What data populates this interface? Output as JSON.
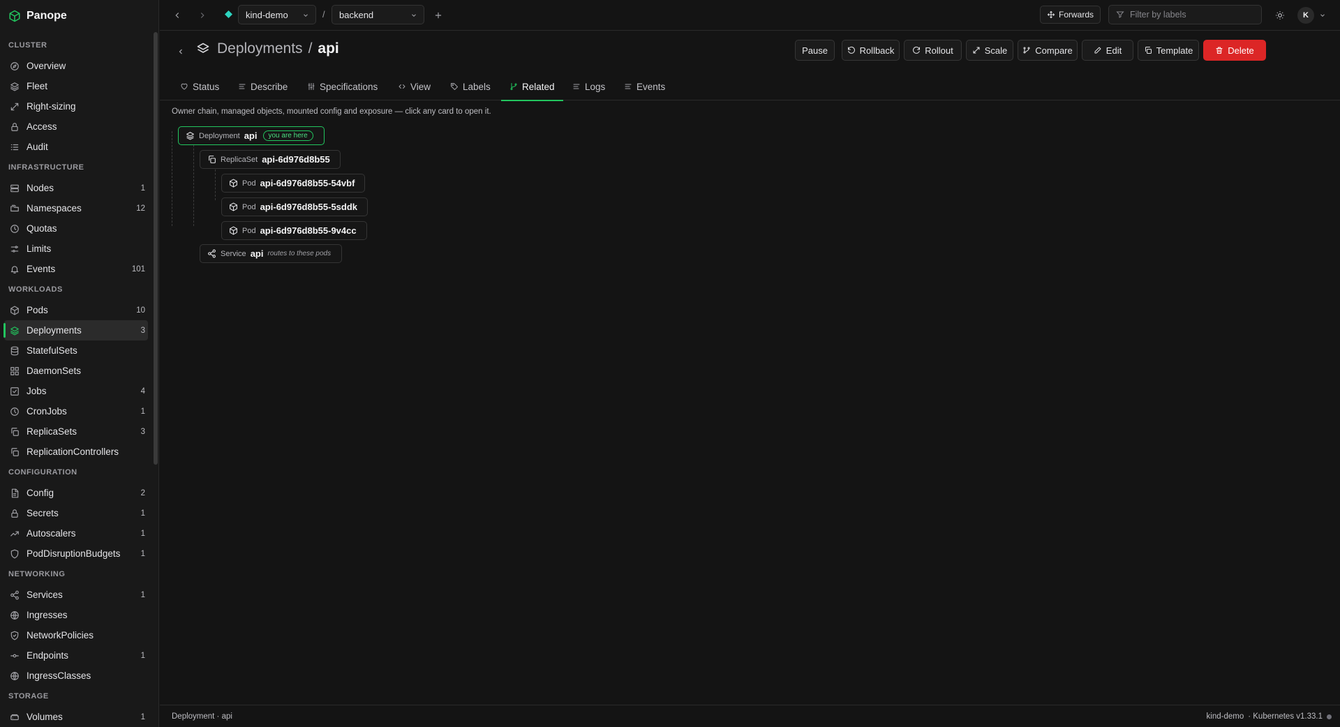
{
  "app": {
    "name": "Panope"
  },
  "colors": {
    "accent": "#22c55e",
    "danger": "#dc2626",
    "background": "#141414",
    "sidebar": "#191919"
  },
  "sidebar": {
    "sections": [
      {
        "title": "CLUSTER",
        "items": [
          {
            "label": "Overview",
            "icon": "compass-icon"
          },
          {
            "label": "Fleet",
            "icon": "layers-icon"
          },
          {
            "label": "Right-sizing",
            "icon": "resize-icon"
          },
          {
            "label": "Access",
            "icon": "lock-icon"
          },
          {
            "label": "Audit",
            "icon": "list-icon"
          }
        ]
      },
      {
        "title": "INFRASTRUCTURE",
        "items": [
          {
            "label": "Nodes",
            "icon": "server-icon",
            "count": "1"
          },
          {
            "label": "Namespaces",
            "icon": "folders-icon",
            "count": "12"
          },
          {
            "label": "Quotas",
            "icon": "gauge-icon"
          },
          {
            "label": "Limits",
            "icon": "sliders-icon"
          },
          {
            "label": "Events",
            "icon": "bell-icon",
            "count": "101"
          }
        ]
      },
      {
        "title": "WORKLOADS",
        "items": [
          {
            "label": "Pods",
            "icon": "box-icon",
            "count": "10"
          },
          {
            "label": "Deployments",
            "icon": "layers-icon",
            "count": "3",
            "active": true
          },
          {
            "label": "StatefulSets",
            "icon": "database-icon"
          },
          {
            "label": "DaemonSets",
            "icon": "grid-icon"
          },
          {
            "label": "Jobs",
            "icon": "check-square-icon",
            "count": "4"
          },
          {
            "label": "CronJobs",
            "icon": "clock-icon",
            "count": "1"
          },
          {
            "label": "ReplicaSets",
            "icon": "copy-icon",
            "count": "3"
          },
          {
            "label": "ReplicationControllers",
            "icon": "copy-icon"
          }
        ]
      },
      {
        "title": "CONFIGURATION",
        "items": [
          {
            "label": "Config",
            "icon": "file-icon",
            "count": "2"
          },
          {
            "label": "Secrets",
            "icon": "lock-icon",
            "count": "1"
          },
          {
            "label": "Autoscalers",
            "icon": "trending-up-icon",
            "count": "1"
          },
          {
            "label": "PodDisruptionBudgets",
            "icon": "shield-icon",
            "count": "1"
          }
        ]
      },
      {
        "title": "NETWORKING",
        "items": [
          {
            "label": "Services",
            "icon": "share-icon",
            "count": "1"
          },
          {
            "label": "Ingresses",
            "icon": "globe-icon"
          },
          {
            "label": "NetworkPolicies",
            "icon": "shield-check-icon"
          },
          {
            "label": "Endpoints",
            "icon": "endpoint-icon",
            "count": "1"
          },
          {
            "label": "IngressClasses",
            "icon": "globe-icon"
          }
        ]
      },
      {
        "title": "STORAGE",
        "items": [
          {
            "label": "Volumes",
            "icon": "drive-icon",
            "count": "1"
          }
        ]
      }
    ]
  },
  "topbar": {
    "context": "kind-demo",
    "namespace": "backend",
    "separator": "/",
    "forwards_label": "Forwards",
    "filter_placeholder": "Filter by labels",
    "avatar_initial": "K"
  },
  "page": {
    "kind": "Deployments",
    "separator": "/",
    "name": "api",
    "actions": [
      "Pause",
      "Rollback",
      "Rollout",
      "Scale",
      "Compare",
      "Edit",
      "Template",
      "Delete"
    ],
    "tabs": [
      "Status",
      "Describe",
      "Specifications",
      "View",
      "Labels",
      "Related",
      "Logs",
      "Events"
    ],
    "active_tab": "Related"
  },
  "related": {
    "hint": "Owner chain, managed objects, mounted config and exposure — click any card to open it.",
    "deployment": {
      "kind": "Deployment",
      "name": "api",
      "badge": "you are here"
    },
    "replicaset": {
      "kind": "ReplicaSet",
      "name": "api-6d976d8b55"
    },
    "pods": [
      {
        "kind": "Pod",
        "name": "api-6d976d8b55-54vbf"
      },
      {
        "kind": "Pod",
        "name": "api-6d976d8b55-5sddk"
      },
      {
        "kind": "Pod",
        "name": "api-6d976d8b55-9v4cc"
      }
    ],
    "service": {
      "kind": "Service",
      "name": "api",
      "note": "routes to these pods"
    }
  },
  "footer": {
    "left": "Deployment · api",
    "cluster": "kind-demo",
    "version": "· Kubernetes v1.33.1"
  }
}
